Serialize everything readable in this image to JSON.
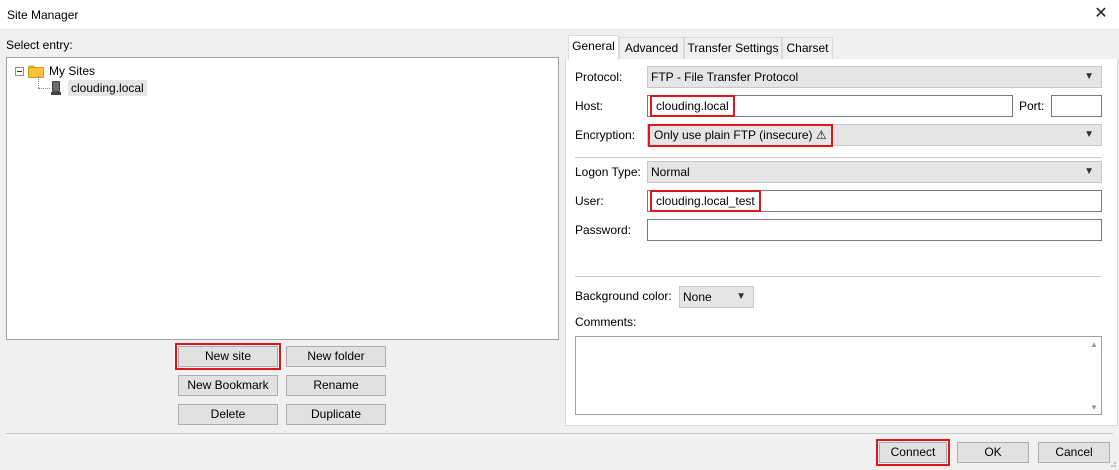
{
  "window": {
    "title": "Site Manager",
    "close_glyph": "✕"
  },
  "left": {
    "select_label": "Select entry:",
    "tree": {
      "root": {
        "label": "My Sites",
        "icon": "folder-icon"
      },
      "child": {
        "label": "clouding.local",
        "icon": "server-icon"
      }
    },
    "buttons": {
      "new_site": "New site",
      "new_folder": "New folder",
      "new_bookmark": "New Bookmark",
      "rename": "Rename",
      "delete": "Delete",
      "duplicate": "Duplicate"
    }
  },
  "tabs": [
    "General",
    "Advanced",
    "Transfer Settings",
    "Charset"
  ],
  "general": {
    "protocol_label": "Protocol:",
    "protocol_value": "FTP - File Transfer Protocol",
    "host_label": "Host:",
    "host_value": "clouding.local",
    "port_label": "Port:",
    "port_value": "",
    "encryption_label": "Encryption:",
    "encryption_value": "Only use plain FTP (insecure) ⚠",
    "logon_label": "Logon Type:",
    "logon_value": "Normal",
    "user_label": "User:",
    "user_value": "clouding.local_test",
    "password_label": "Password:",
    "password_value": "",
    "bgcolor_label": "Background color:",
    "bgcolor_value": "None",
    "comments_label": "Comments:",
    "comments_value": ""
  },
  "footer": {
    "connect": "Connect",
    "ok": "OK",
    "cancel": "Cancel"
  },
  "colors": {
    "highlight": "#e0161d",
    "combo_bg": "#e5e5e5",
    "panel_bg": "#ffffff"
  }
}
